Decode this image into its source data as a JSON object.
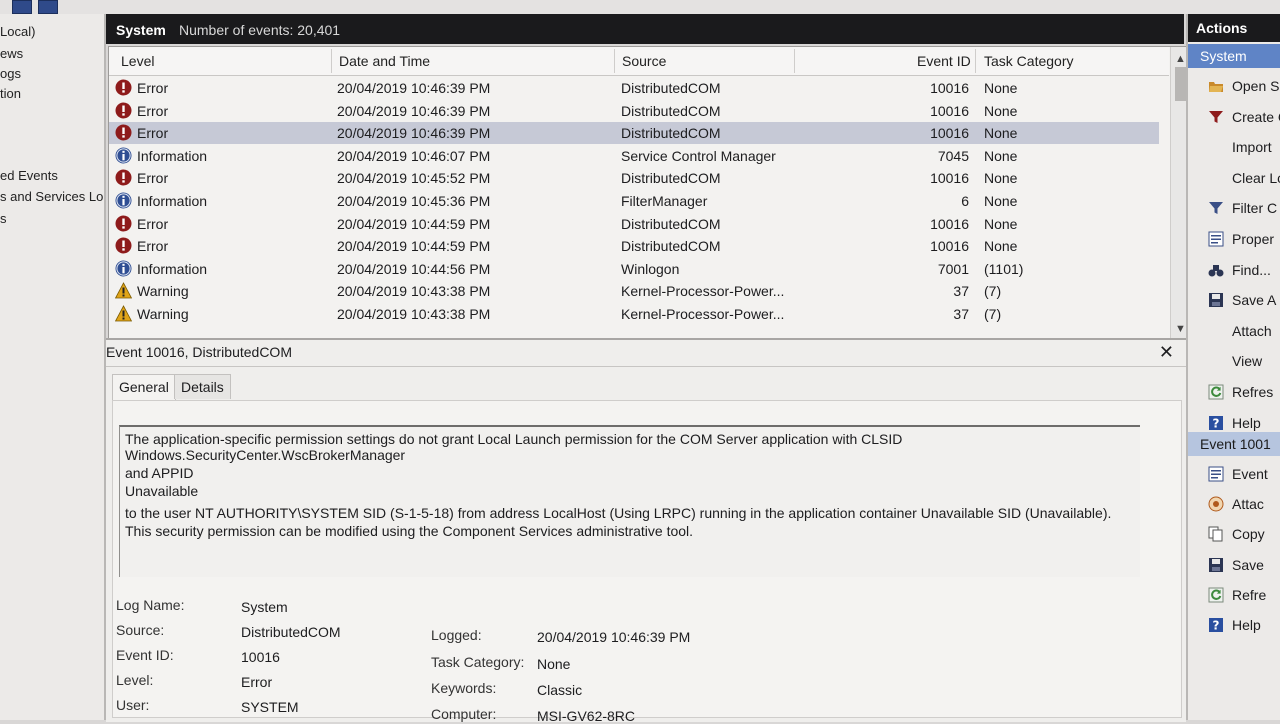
{
  "tree": {
    "items": [
      "Local)",
      "ews",
      "ogs",
      "tion",
      "ed Events",
      "s and Services Lo",
      "s"
    ]
  },
  "header": {
    "log_name": "System",
    "event_count": "Number of events: 20,401"
  },
  "grid": {
    "columns": [
      "Level",
      "Date and Time",
      "Source",
      "Event ID",
      "Task Category"
    ],
    "rows": [
      {
        "level": "Error",
        "icon": "error-icon",
        "datetime": "20/04/2019 10:46:39 PM",
        "source": "DistributedCOM",
        "event_id": "10016",
        "category": "None",
        "selected": false
      },
      {
        "level": "Error",
        "icon": "error-icon",
        "datetime": "20/04/2019 10:46:39 PM",
        "source": "DistributedCOM",
        "event_id": "10016",
        "category": "None",
        "selected": false
      },
      {
        "level": "Error",
        "icon": "error-icon",
        "datetime": "20/04/2019 10:46:39 PM",
        "source": "DistributedCOM",
        "event_id": "10016",
        "category": "None",
        "selected": true
      },
      {
        "level": "Information",
        "icon": "info-icon",
        "datetime": "20/04/2019 10:46:07 PM",
        "source": "Service Control Manager",
        "event_id": "7045",
        "category": "None",
        "selected": false
      },
      {
        "level": "Error",
        "icon": "error-icon",
        "datetime": "20/04/2019 10:45:52 PM",
        "source": "DistributedCOM",
        "event_id": "10016",
        "category": "None",
        "selected": false
      },
      {
        "level": "Information",
        "icon": "info-icon",
        "datetime": "20/04/2019 10:45:36 PM",
        "source": "FilterManager",
        "event_id": "6",
        "category": "None",
        "selected": false
      },
      {
        "level": "Error",
        "icon": "error-icon",
        "datetime": "20/04/2019 10:44:59 PM",
        "source": "DistributedCOM",
        "event_id": "10016",
        "category": "None",
        "selected": false
      },
      {
        "level": "Error",
        "icon": "error-icon",
        "datetime": "20/04/2019 10:44:59 PM",
        "source": "DistributedCOM",
        "event_id": "10016",
        "category": "None",
        "selected": false
      },
      {
        "level": "Information",
        "icon": "info-icon",
        "datetime": "20/04/2019 10:44:56 PM",
        "source": "Winlogon",
        "event_id": "7001",
        "category": "(1101)",
        "selected": false
      },
      {
        "level": "Warning",
        "icon": "warning-icon",
        "datetime": "20/04/2019 10:43:38 PM",
        "source": "Kernel-Processor-Power...",
        "event_id": "37",
        "category": "(7)",
        "selected": false
      },
      {
        "level": "Warning",
        "icon": "warning-icon",
        "datetime": "20/04/2019 10:43:38 PM",
        "source": "Kernel-Processor-Power...",
        "event_id": "37",
        "category": "(7)",
        "selected": false
      }
    ]
  },
  "detail": {
    "title": "Event 10016, DistributedCOM",
    "close": "✕",
    "tabs": [
      "General",
      "Details"
    ],
    "message_lines": [
      "The application-specific permission settings do not grant Local Launch permission for the COM Server application with CLSID",
      "Windows.SecurityCenter.WscBrokerManager",
      " and APPID",
      "Unavailable",
      " to the user NT AUTHORITY\\SYSTEM SID (S-1-5-18) from address LocalHost (Using LRPC) running in the application container Unavailable SID (Unavailable).",
      "This security permission can be modified using the Component Services administrative tool."
    ],
    "fields_left": [
      {
        "label": "Log Name:",
        "value": "System"
      },
      {
        "label": "Source:",
        "value": "DistributedCOM"
      },
      {
        "label": "Event ID:",
        "value": "10016"
      },
      {
        "label": "Level:",
        "value": "Error"
      },
      {
        "label": "User:",
        "value": "SYSTEM"
      }
    ],
    "fields_right": [
      {
        "label": "Logged:",
        "value": "20/04/2019 10:46:39 PM"
      },
      {
        "label": "Task Category:",
        "value": "None"
      },
      {
        "label": "Keywords:",
        "value": "Classic"
      },
      {
        "label": "Computer:",
        "value": "MSI-GV62-8RC"
      }
    ]
  },
  "actions": {
    "title": "Actions",
    "section1": "System",
    "items1": [
      {
        "label": "Open Sa",
        "icon": "folder-open-icon"
      },
      {
        "label": "Create C",
        "icon": "filter-create-icon"
      },
      {
        "label": "Import",
        "icon": ""
      },
      {
        "label": "Clear Lo",
        "icon": ""
      },
      {
        "label": "Filter C",
        "icon": "filter-icon"
      },
      {
        "label": "Proper",
        "icon": "properties-icon"
      },
      {
        "label": "Find...",
        "icon": "binoculars-icon"
      },
      {
        "label": "Save A",
        "icon": "save-icon"
      },
      {
        "label": "Attach",
        "icon": ""
      },
      {
        "label": "View",
        "icon": ""
      },
      {
        "label": "Refres",
        "icon": "refresh-icon"
      },
      {
        "label": "Help",
        "icon": "help-icon"
      }
    ],
    "section2": "Event 1001",
    "items2": [
      {
        "label": "Event",
        "icon": "event-properties-icon"
      },
      {
        "label": "Attac",
        "icon": "attach-task-icon"
      },
      {
        "label": "Copy",
        "icon": "copy-icon"
      },
      {
        "label": "Save",
        "icon": "save-icon"
      },
      {
        "label": "Refre",
        "icon": "refresh-icon"
      },
      {
        "label": "Help",
        "icon": "help-icon"
      }
    ]
  },
  "colors": {
    "error": "#8e1b1b",
    "info": "#2f4e93",
    "warning": "#e0a418",
    "selection": "#c6c9d6",
    "section_blue": "#5f84c6"
  }
}
